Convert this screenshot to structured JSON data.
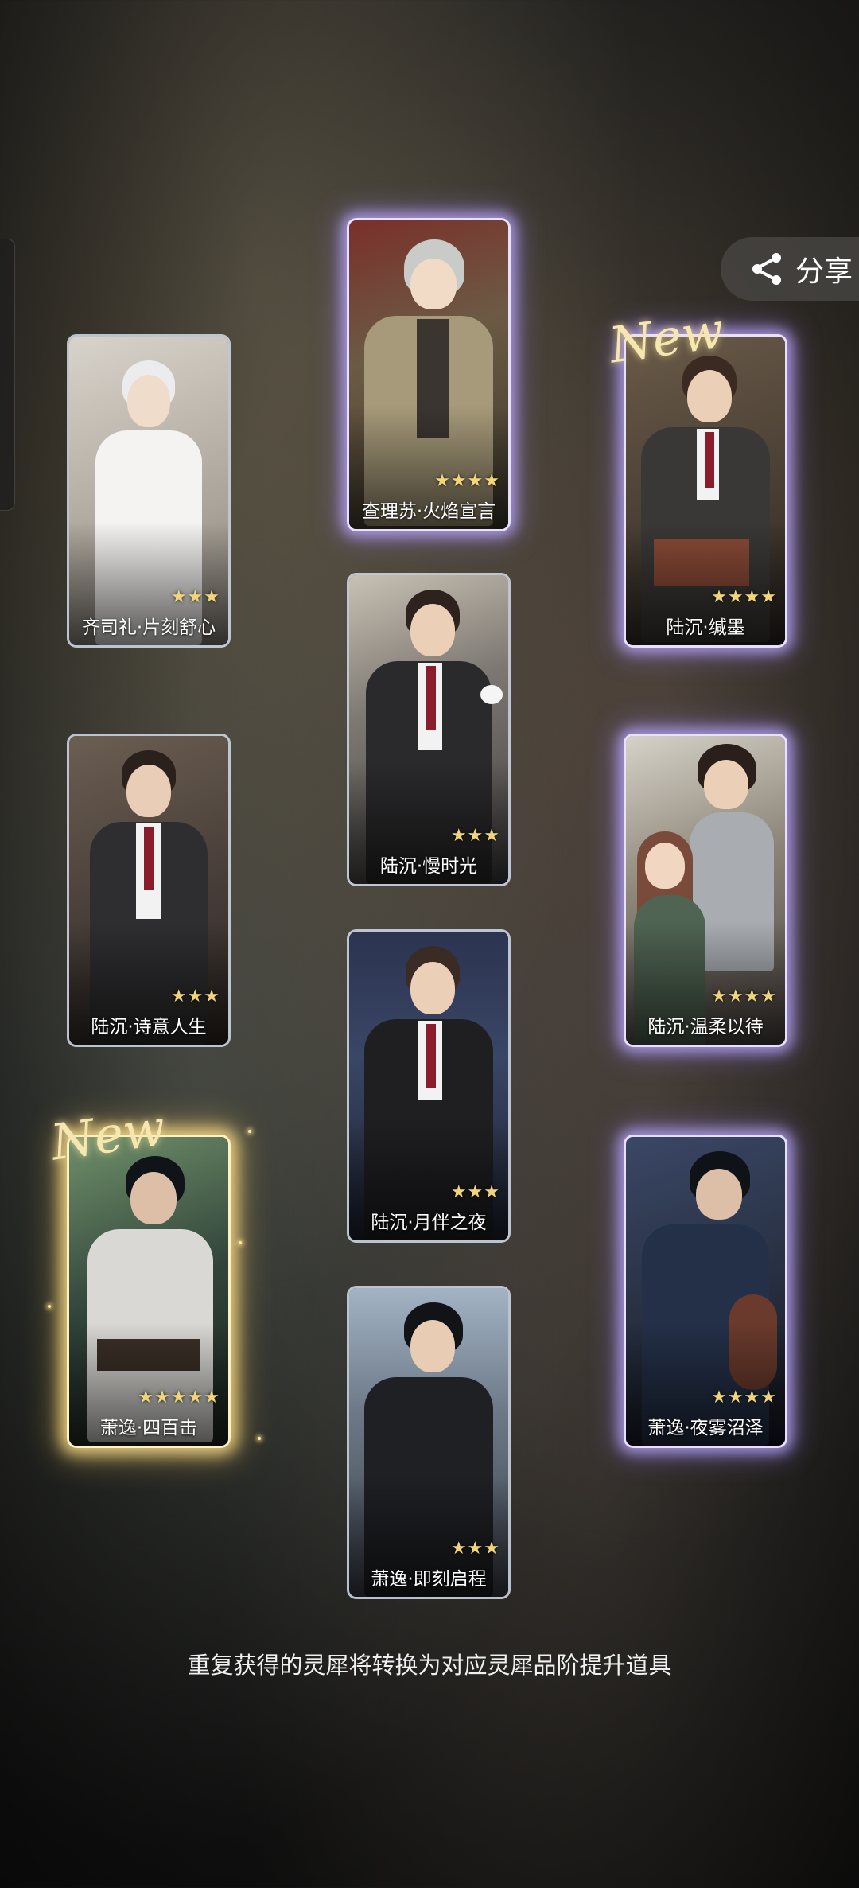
{
  "share": {
    "label": "分享",
    "icon": "share-icon"
  },
  "new_badge": "New",
  "cards": [
    {
      "id": "qisili",
      "name": "齐司礼·片刻舒心",
      "stars": "★★★",
      "bg": "#b9b2a8"
    },
    {
      "id": "chalisu",
      "name": "查理苏·火焰宣言",
      "stars": "★★★★",
      "bg": "#6c5a44"
    },
    {
      "id": "luchen-xiemo",
      "name": "陆沉·缄墨",
      "stars": "★★★★",
      "bg": "#4f4438",
      "new": true
    },
    {
      "id": "luchen-manshiguang",
      "name": "陆沉·慢时光",
      "stars": "★★★",
      "bg": "#6f6b6a"
    },
    {
      "id": "luchen-shiyi",
      "name": "陆沉·诗意人生",
      "stars": "★★★",
      "bg": "#4a403a"
    },
    {
      "id": "luchen-wenrou",
      "name": "陆沉·温柔以待",
      "stars": "★★★★",
      "bg": "#8c8478"
    },
    {
      "id": "luchen-yueban",
      "name": "陆沉·月伴之夜",
      "stars": "★★★",
      "bg": "#2f3a52"
    },
    {
      "id": "xiaoyi-sibaiji",
      "name": "萧逸·四百击",
      "stars": "★★★★★",
      "bg": "#31443a",
      "new": true
    },
    {
      "id": "xiaoyi-yewu",
      "name": "萧逸·夜雾沼泽",
      "stars": "★★★★",
      "bg": "#2a3346"
    },
    {
      "id": "xiaoyi-jike",
      "name": "萧逸·即刻启程",
      "stars": "★★★",
      "bg": "#6d7988"
    }
  ],
  "footer_note": "重复获得的灵犀将转换为对应灵犀品阶提升道具"
}
